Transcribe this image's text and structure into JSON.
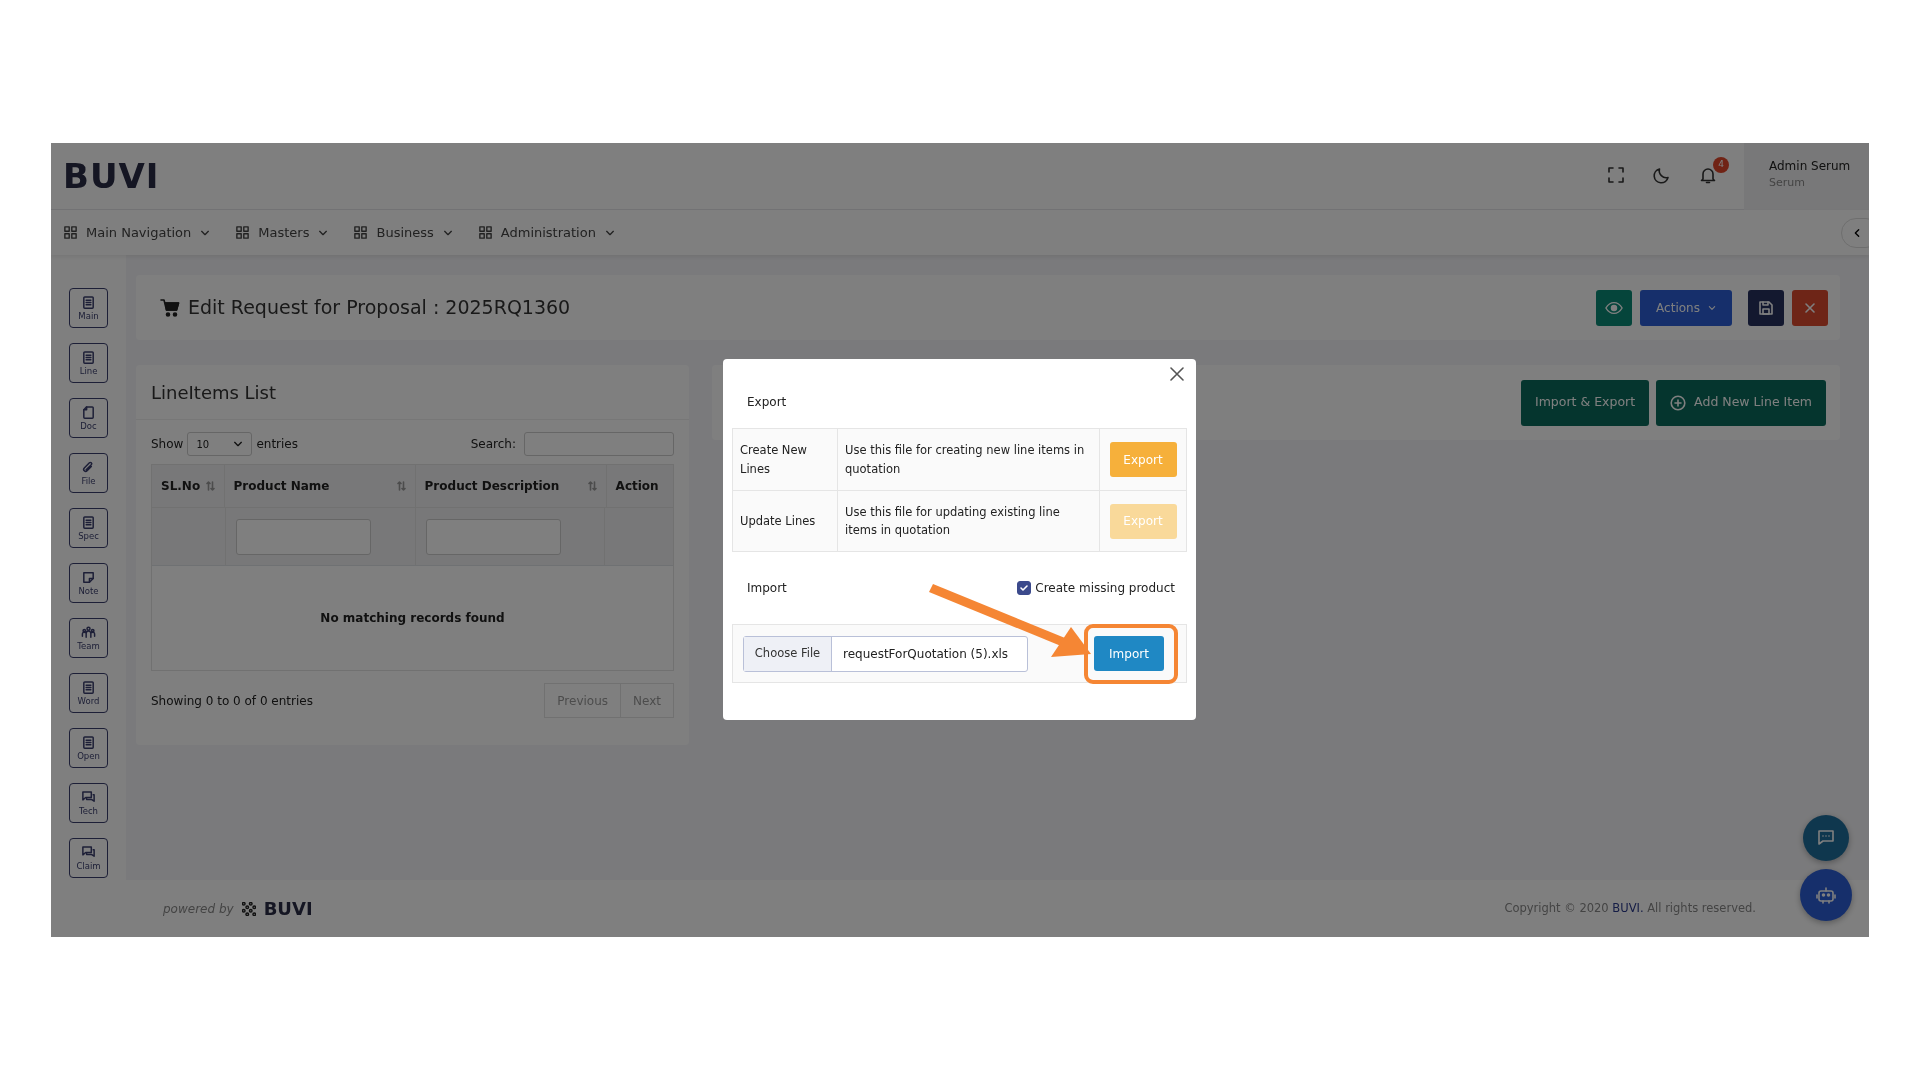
{
  "header": {
    "logo": "BUVI",
    "notification_count": "4",
    "user_name": "Admin Serum",
    "user_role": "Serum"
  },
  "nav": [
    {
      "label": "Main Navigation"
    },
    {
      "label": "Masters"
    },
    {
      "label": "Business"
    },
    {
      "label": "Administration"
    }
  ],
  "sidebar": [
    {
      "label": "Main",
      "kind": "list"
    },
    {
      "label": "Line",
      "kind": "list"
    },
    {
      "label": "Doc",
      "kind": "page"
    },
    {
      "label": "File",
      "kind": "clip"
    },
    {
      "label": "Spec",
      "kind": "list"
    },
    {
      "label": "Note",
      "kind": "note"
    },
    {
      "label": "Team",
      "kind": "team"
    },
    {
      "label": "Word",
      "kind": "list"
    },
    {
      "label": "Open",
      "kind": "list"
    },
    {
      "label": "Tech",
      "kind": "chat"
    },
    {
      "label": "Claim",
      "kind": "chat"
    }
  ],
  "page": {
    "title": "Edit Request for Proposal : 2025RQ1360",
    "actions_label": "Actions"
  },
  "lineitems": {
    "title": "LineItems List",
    "show": "Show",
    "page_size": "10",
    "entries": "entries",
    "search_label": "Search:",
    "columns": [
      {
        "label": "SL.No",
        "sortable": true
      },
      {
        "label": "Product Name",
        "sortable": true
      },
      {
        "label": "Product Description",
        "sortable": true
      },
      {
        "label": "Action",
        "sortable": false
      }
    ],
    "empty": "No matching records found",
    "info": "Showing 0 to 0 of 0 entries",
    "previous": "Previous",
    "next": "Next"
  },
  "toolbar": {
    "import_export": "Import & Export",
    "add_line": "Add New Line Item"
  },
  "footer": {
    "powered_by": "powered by",
    "brand": "BUVI",
    "copyright_prefix": "Copyright © 2020",
    "copyright_brand": "BUVI.",
    "copyright_suffix": "All rights reserved."
  },
  "modal": {
    "export_title": "Export",
    "export_rows": [
      {
        "name": "Create New Lines",
        "description": "Use this file for creating new line items in quotation",
        "button": "Export",
        "disabled": false
      },
      {
        "name": "Update Lines",
        "description": "Use this file for updating existing line items in quotation",
        "button": "Export",
        "disabled": true
      }
    ],
    "import_title": "Import",
    "create_missing": {
      "label": "Create missing product",
      "checked": true
    },
    "choose_file": "Choose File",
    "file_name": "requestForQuotation (5).xls",
    "import_button": "Import"
  }
}
